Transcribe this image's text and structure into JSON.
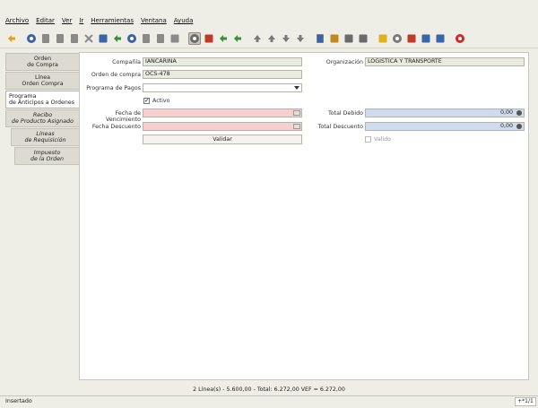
{
  "menu": [
    {
      "label": "Archivo",
      "u": 0
    },
    {
      "label": "Editar",
      "u": 0
    },
    {
      "label": "Ver",
      "u": 0
    },
    {
      "label": "Ir",
      "u": 0
    },
    {
      "label": "Herramientas",
      "u": 0
    },
    {
      "label": "Ventana",
      "u": 0
    },
    {
      "label": "Ayuda",
      "u": 0
    }
  ],
  "toolbar": [
    {
      "name": "undo-icon",
      "color": "#e0a020",
      "shape": "arrow"
    },
    {
      "name": "sep"
    },
    {
      "name": "help-icon",
      "color": "#3a63a8",
      "shape": "circle"
    },
    {
      "name": "new-record-icon",
      "color": "#8a8a8a",
      "shape": "doc"
    },
    {
      "name": "copy-record-icon",
      "color": "#8a8a8a",
      "shape": "doc"
    },
    {
      "name": "delete-record-icon",
      "color": "#8a8a8a",
      "shape": "doc"
    },
    {
      "name": "delete-selection-icon",
      "color": "#8a8a8a",
      "shape": "x"
    },
    {
      "name": "save-icon",
      "color": "#3a63a8",
      "shape": "square"
    },
    {
      "name": "refresh-icon",
      "color": "#3a8a3a",
      "shape": "arrow"
    },
    {
      "name": "find-icon",
      "color": "#3a63a8",
      "shape": "circle"
    },
    {
      "name": "attachment-icon",
      "color": "#8a8a8a",
      "shape": "doc"
    },
    {
      "name": "chat-icon",
      "color": "#8a8a8a",
      "shape": "doc"
    },
    {
      "name": "grid-toggle-icon",
      "color": "#8a8a8a",
      "shape": "square"
    },
    {
      "name": "sep"
    },
    {
      "name": "history-icon",
      "color": "#6a6a6a",
      "shape": "circle",
      "pressed": true
    },
    {
      "name": "home-icon",
      "color": "#c03a2a",
      "shape": "square"
    },
    {
      "name": "back-icon",
      "color": "#3a8a3a",
      "shape": "arrow"
    },
    {
      "name": "forward-icon",
      "color": "#3a8a3a",
      "shape": "arrow"
    },
    {
      "name": "sep"
    },
    {
      "name": "first-record-icon",
      "color": "#7a7a7a",
      "shape": "up"
    },
    {
      "name": "previous-record-icon",
      "color": "#7a7a7a",
      "shape": "up"
    },
    {
      "name": "next-record-icon",
      "color": "#7a7a7a",
      "shape": "down"
    },
    {
      "name": "last-record-icon",
      "color": "#7a7a7a",
      "shape": "down"
    },
    {
      "name": "sep"
    },
    {
      "name": "report-icon",
      "color": "#3a63a8",
      "shape": "doc"
    },
    {
      "name": "archive-icon",
      "color": "#c08a20",
      "shape": "square"
    },
    {
      "name": "print-preview-icon",
      "color": "#6a6a6a",
      "shape": "square"
    },
    {
      "name": "print-icon",
      "color": "#6a6a6a",
      "shape": "square"
    },
    {
      "name": "sep"
    },
    {
      "name": "lock-icon",
      "color": "#e0b020",
      "shape": "square"
    },
    {
      "name": "zoom-across-icon",
      "color": "#7a7a7a",
      "shape": "circle"
    },
    {
      "name": "workflow-icon",
      "color": "#c03a2a",
      "shape": "square"
    },
    {
      "name": "process-icon",
      "color": "#3a63a8",
      "shape": "square"
    },
    {
      "name": "product-info-icon",
      "color": "#3a63a8",
      "shape": "square"
    },
    {
      "name": "sep"
    },
    {
      "name": "exit-icon",
      "color": "#d02a2a",
      "shape": "circle"
    }
  ],
  "tabs": [
    {
      "label_lines": [
        "Orden",
        "de Compra"
      ],
      "style": ""
    },
    {
      "label_lines": [
        "Línea",
        "Orden Compra"
      ],
      "style": ""
    },
    {
      "label_lines": [
        "Programa",
        "de Anticipos a Ordenes"
      ],
      "style": "active"
    },
    {
      "label_lines": [
        "Recibo",
        "de Producto Asignado"
      ],
      "style": "italic"
    },
    {
      "label_lines": [
        "Líneas",
        "de Requisición"
      ],
      "style": "italic indent"
    },
    {
      "label_lines": [
        "Impuesto",
        "de la Orden"
      ],
      "style": "italic indent2"
    }
  ],
  "form": {
    "company_label": "Compañía",
    "company_value": "IANCARINA",
    "organization_label": "Organización",
    "organization_value": "LOGISTICA Y TRANSPORTE",
    "po_label": "Orden de compra",
    "po_value": "OCS-478",
    "payment_schedule_label": "Programa de Pagos",
    "payment_schedule_value": "",
    "active_label": "Activo",
    "due_date_label": "Fecha de Vencimiento",
    "due_date_value": "",
    "due_amount_label": "Total Debido",
    "due_amount_value": "0,00",
    "discount_date_label": "Fecha Descuento",
    "discount_date_value": "",
    "discount_amount_label": "Total Descuento",
    "discount_amount_value": "0,00",
    "valid_label": "Valido",
    "validate_button": "Validar"
  },
  "summary": "2 Línea(s) - 5.600,00 - Total: 6.272,00  VEF = 6.272,00",
  "status": {
    "text": "Insertado",
    "record": "+*1/1"
  }
}
